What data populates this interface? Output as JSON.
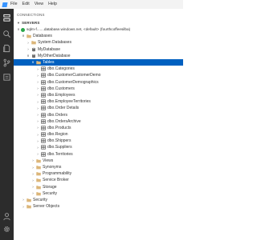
{
  "menu": [
    "File",
    "Edit",
    "View",
    "Help"
  ],
  "sections": {
    "connections": "CONNECTIONS",
    "servers": "SERVERS"
  },
  "tree": [
    {
      "level": 0,
      "expanded": true,
      "icon": "server-icon",
      "label": "sqlm-f.......database.windows.net, <default> (fourthcoffeesilba)",
      "server": true
    },
    {
      "level": 1,
      "expanded": true,
      "icon": "folder-icon",
      "label": "Databases"
    },
    {
      "level": 2,
      "expanded": false,
      "icon": "folder-icon",
      "label": "System Databases"
    },
    {
      "level": 2,
      "expanded": false,
      "icon": "database-icon",
      "label": "MyDatabase"
    },
    {
      "level": 2,
      "expanded": true,
      "icon": "database-icon",
      "label": "MyOtherDatabase"
    },
    {
      "level": 3,
      "expanded": true,
      "icon": "folder-icon",
      "label": "Tables",
      "selected": true
    },
    {
      "level": 4,
      "expanded": false,
      "icon": "table-icon",
      "label": "dbo.Categories"
    },
    {
      "level": 4,
      "expanded": false,
      "icon": "table-icon",
      "label": "dbo.CustomerCustomerDemo"
    },
    {
      "level": 4,
      "expanded": false,
      "icon": "table-icon",
      "label": "dbo.CustomerDemographics"
    },
    {
      "level": 4,
      "expanded": false,
      "icon": "table-icon",
      "label": "dbo.Customers"
    },
    {
      "level": 4,
      "expanded": false,
      "icon": "table-icon",
      "label": "dbo.Employees"
    },
    {
      "level": 4,
      "expanded": false,
      "icon": "table-icon",
      "label": "dbo.EmployeeTerritories"
    },
    {
      "level": 4,
      "expanded": false,
      "icon": "table-icon",
      "label": "dbo.Order Details"
    },
    {
      "level": 4,
      "expanded": false,
      "icon": "table-icon",
      "label": "dbo.Orders"
    },
    {
      "level": 4,
      "expanded": false,
      "icon": "table-icon",
      "label": "dbo.OrdersArchive"
    },
    {
      "level": 4,
      "expanded": false,
      "icon": "table-icon",
      "label": "dbo.Products"
    },
    {
      "level": 4,
      "expanded": false,
      "icon": "table-icon",
      "label": "dbo.Region"
    },
    {
      "level": 4,
      "expanded": false,
      "icon": "table-icon",
      "label": "dbo.Shippers"
    },
    {
      "level": 4,
      "expanded": false,
      "icon": "table-icon",
      "label": "dbo.Suppliers"
    },
    {
      "level": 4,
      "expanded": false,
      "icon": "table-icon",
      "label": "dbo.Territories"
    },
    {
      "level": 3,
      "expanded": false,
      "icon": "folder-icon",
      "label": "Views"
    },
    {
      "level": 3,
      "expanded": false,
      "icon": "folder-icon",
      "label": "Synonyms"
    },
    {
      "level": 3,
      "expanded": false,
      "icon": "folder-icon",
      "label": "Programmability"
    },
    {
      "level": 3,
      "expanded": false,
      "icon": "folder-icon",
      "label": "Service Broker"
    },
    {
      "level": 3,
      "expanded": false,
      "icon": "folder-icon",
      "label": "Storage"
    },
    {
      "level": 3,
      "expanded": false,
      "icon": "folder-icon",
      "label": "Security"
    },
    {
      "level": 1,
      "expanded": false,
      "icon": "folder-icon",
      "label": "Security"
    },
    {
      "level": 1,
      "expanded": false,
      "icon": "folder-icon",
      "label": "Server Objects"
    }
  ],
  "colors": {
    "selection": "#0060c0",
    "activity_bar": "#2c2c2c",
    "folder": "#dcb67a",
    "table": "#424242",
    "database": "#707070",
    "server_status": "#2aa64a",
    "accent": "#3794ff"
  }
}
